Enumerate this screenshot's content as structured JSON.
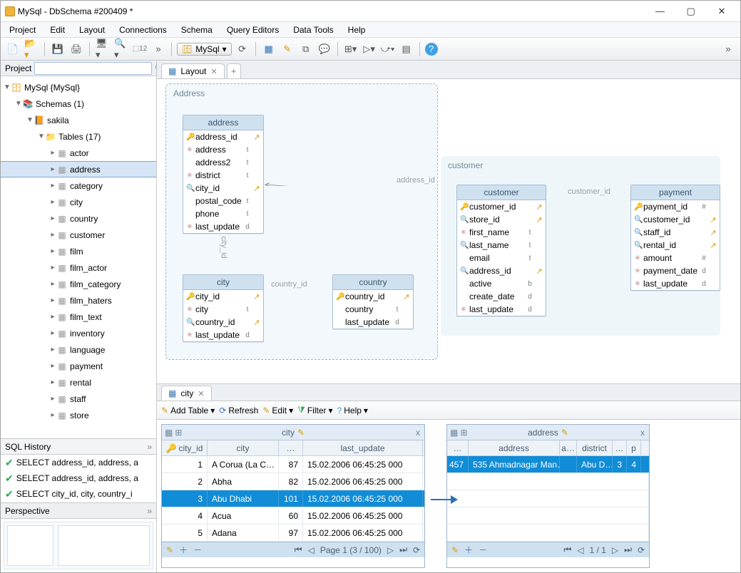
{
  "window": {
    "title": "MySql - DbSchema #200409 *"
  },
  "menu": [
    "Project",
    "Edit",
    "Layout",
    "Connections",
    "Schema",
    "Query Editors",
    "Data Tools",
    "Help"
  ],
  "toolbar": {
    "connection": "MySql"
  },
  "project_panel": {
    "label": "Project",
    "root": "MySql {MySql}",
    "schemas_label": "Schemas (1)",
    "schema_name": "sakila",
    "tables_label": "Tables (17)",
    "tables": [
      "actor",
      "address",
      "category",
      "city",
      "country",
      "customer",
      "film",
      "film_actor",
      "film_category",
      "film_haters",
      "film_text",
      "inventory",
      "language",
      "payment",
      "rental",
      "staff",
      "store"
    ],
    "selected_table": "address"
  },
  "sql_history": {
    "title": "SQL History",
    "items": [
      "SELECT address_id, address, a",
      "SELECT address_id, address, a",
      "SELECT city_id, city, country_i"
    ]
  },
  "perspective": {
    "title": "Perspective"
  },
  "layout_tab": {
    "label": "Layout"
  },
  "diagram": {
    "group_address_title": "Address",
    "group_customer_title": "customer",
    "link_labels": {
      "city_id": "city_id",
      "country_id": "country_id",
      "address_id": "address_id",
      "customer_id": "customer_id"
    },
    "entities": {
      "address": {
        "title": "address",
        "cols": [
          {
            "flag": "key",
            "name": "address_id",
            "t": "",
            "a": "↗"
          },
          {
            "flag": "x",
            "name": "address",
            "t": "t",
            "a": ""
          },
          {
            "flag": "",
            "name": "address2",
            "t": "t",
            "a": ""
          },
          {
            "flag": "x",
            "name": "district",
            "t": "t",
            "a": ""
          },
          {
            "flag": "fk",
            "name": "city_id",
            "t": "",
            "a": "↗"
          },
          {
            "flag": "",
            "name": "postal_code",
            "t": "t",
            "a": ""
          },
          {
            "flag": "",
            "name": "phone",
            "t": "t",
            "a": ""
          },
          {
            "flag": "x",
            "name": "last_update",
            "t": "d",
            "a": ""
          }
        ]
      },
      "city": {
        "title": "city",
        "cols": [
          {
            "flag": "key",
            "name": "city_id",
            "t": "",
            "a": "↗"
          },
          {
            "flag": "x",
            "name": "city",
            "t": "t",
            "a": ""
          },
          {
            "flag": "fk",
            "name": "country_id",
            "t": "",
            "a": "↗"
          },
          {
            "flag": "x",
            "name": "last_update",
            "t": "d",
            "a": ""
          }
        ]
      },
      "country": {
        "title": "country",
        "cols": [
          {
            "flag": "key",
            "name": "country_id",
            "t": "",
            "a": "↗"
          },
          {
            "flag": "",
            "name": "country",
            "t": "t",
            "a": ""
          },
          {
            "flag": "",
            "name": "last_update",
            "t": "d",
            "a": ""
          }
        ]
      },
      "customer": {
        "title": "customer",
        "cols": [
          {
            "flag": "key",
            "name": "customer_id",
            "t": "",
            "a": "↗"
          },
          {
            "flag": "fk",
            "name": "store_id",
            "t": "",
            "a": "↗"
          },
          {
            "flag": "x",
            "name": "first_name",
            "t": "t",
            "a": ""
          },
          {
            "flag": "fk",
            "name": "last_name",
            "t": "t",
            "a": ""
          },
          {
            "flag": "",
            "name": "email",
            "t": "t",
            "a": ""
          },
          {
            "flag": "fk",
            "name": "address_id",
            "t": "",
            "a": "↗"
          },
          {
            "flag": "",
            "name": "active",
            "t": "b",
            "a": ""
          },
          {
            "flag": "",
            "name": "create_date",
            "t": "d",
            "a": ""
          },
          {
            "flag": "x",
            "name": "last_update",
            "t": "d",
            "a": ""
          }
        ]
      },
      "payment": {
        "title": "payment",
        "cols": [
          {
            "flag": "key",
            "name": "payment_id",
            "t": "#",
            "a": ""
          },
          {
            "flag": "fk",
            "name": "customer_id",
            "t": "",
            "a": "↗"
          },
          {
            "flag": "fk",
            "name": "staff_id",
            "t": "",
            "a": "↗"
          },
          {
            "flag": "fk",
            "name": "rental_id",
            "t": "",
            "a": "↗"
          },
          {
            "flag": "x",
            "name": "amount",
            "t": "#",
            "a": ""
          },
          {
            "flag": "x",
            "name": "payment_date",
            "t": "d",
            "a": ""
          },
          {
            "flag": "x",
            "name": "last_update",
            "t": "d",
            "a": ""
          }
        ]
      }
    }
  },
  "browse": {
    "tab": "city",
    "toolbar": {
      "add_table": "Add Table",
      "refresh": "Refresh",
      "edit": "Edit",
      "filter": "Filter",
      "help": "Help"
    },
    "city_grid": {
      "title": "city",
      "headers": [
        "city_id",
        "city",
        "…",
        "last_update"
      ],
      "rows": [
        {
          "id": "1",
          "city": "A Corua (La C…",
          "c": "87",
          "upd": "15.02.2006 06:45:25 000"
        },
        {
          "id": "2",
          "city": "Abha",
          "c": "82",
          "upd": "15.02.2006 06:45:25 000"
        },
        {
          "id": "3",
          "city": "Abu Dhabi",
          "c": "101",
          "upd": "15.02.2006 06:45:25 000"
        },
        {
          "id": "4",
          "city": "Acua",
          "c": "60",
          "upd": "15.02.2006 06:45:25 000"
        },
        {
          "id": "5",
          "city": "Adana",
          "c": "97",
          "upd": "15.02.2006 06:45:25 000"
        }
      ],
      "selected_index": 2,
      "pager": "Page 1 (3 / 100)"
    },
    "address_grid": {
      "title": "address",
      "headers": [
        "…",
        "address",
        "a…",
        "district",
        "…",
        "p"
      ],
      "rows": [
        {
          "id": "457",
          "address": "535 Ahmadnagar Man…",
          "a": "",
          "district": "Abu D…",
          "c": "3",
          "p": "4"
        }
      ],
      "pager": "1 / 1"
    }
  }
}
